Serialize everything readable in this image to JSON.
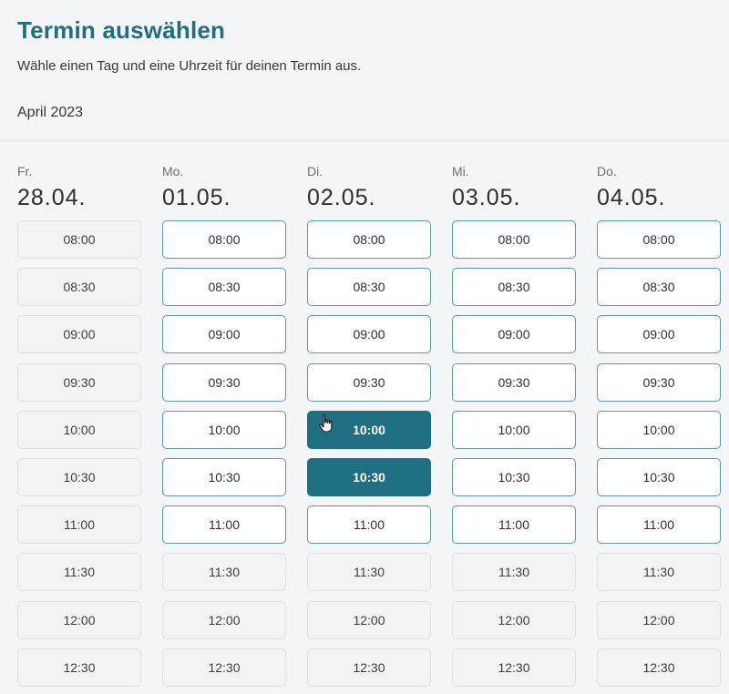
{
  "header": {
    "title": "Termin auswählen",
    "subtitle": "Wähle einen Tag und eine Uhrzeit für deinen Termin aus.",
    "month": "April 2023"
  },
  "colors": {
    "accent": "#1f6f82",
    "available_border": "#5a9aa8",
    "disabled_bg": "#f2f3f4"
  },
  "days": [
    {
      "weekday": "Fr.",
      "date": "28.04.",
      "slots": [
        {
          "time": "08:00",
          "state": "disabled"
        },
        {
          "time": "08:30",
          "state": "disabled"
        },
        {
          "time": "09:00",
          "state": "disabled"
        },
        {
          "time": "09:30",
          "state": "disabled"
        },
        {
          "time": "10:00",
          "state": "disabled"
        },
        {
          "time": "10:30",
          "state": "disabled"
        },
        {
          "time": "11:00",
          "state": "disabled"
        },
        {
          "time": "11:30",
          "state": "disabled"
        },
        {
          "time": "12:00",
          "state": "disabled"
        },
        {
          "time": "12:30",
          "state": "disabled"
        }
      ]
    },
    {
      "weekday": "Mo.",
      "date": "01.05.",
      "slots": [
        {
          "time": "08:00",
          "state": "available"
        },
        {
          "time": "08:30",
          "state": "available"
        },
        {
          "time": "09:00",
          "state": "available"
        },
        {
          "time": "09:30",
          "state": "available"
        },
        {
          "time": "10:00",
          "state": "available"
        },
        {
          "time": "10:30",
          "state": "available"
        },
        {
          "time": "11:00",
          "state": "available"
        },
        {
          "time": "11:30",
          "state": "disabled"
        },
        {
          "time": "12:00",
          "state": "disabled"
        },
        {
          "time": "12:30",
          "state": "disabled"
        }
      ]
    },
    {
      "weekday": "Di.",
      "date": "02.05.",
      "slots": [
        {
          "time": "08:00",
          "state": "available"
        },
        {
          "time": "08:30",
          "state": "available"
        },
        {
          "time": "09:00",
          "state": "available"
        },
        {
          "time": "09:30",
          "state": "available"
        },
        {
          "time": "10:00",
          "state": "selected"
        },
        {
          "time": "10:30",
          "state": "selected"
        },
        {
          "time": "11:00",
          "state": "available"
        },
        {
          "time": "11:30",
          "state": "disabled"
        },
        {
          "time": "12:00",
          "state": "disabled"
        },
        {
          "time": "12:30",
          "state": "disabled"
        }
      ]
    },
    {
      "weekday": "Mi.",
      "date": "03.05.",
      "slots": [
        {
          "time": "08:00",
          "state": "available"
        },
        {
          "time": "08:30",
          "state": "available"
        },
        {
          "time": "09:00",
          "state": "available"
        },
        {
          "time": "09:30",
          "state": "available"
        },
        {
          "time": "10:00",
          "state": "available"
        },
        {
          "time": "10:30",
          "state": "available"
        },
        {
          "time": "11:00",
          "state": "available"
        },
        {
          "time": "11:30",
          "state": "disabled"
        },
        {
          "time": "12:00",
          "state": "disabled"
        },
        {
          "time": "12:30",
          "state": "disabled"
        }
      ]
    },
    {
      "weekday": "Do.",
      "date": "04.05.",
      "slots": [
        {
          "time": "08:00",
          "state": "available"
        },
        {
          "time": "08:30",
          "state": "available"
        },
        {
          "time": "09:00",
          "state": "available"
        },
        {
          "time": "09:30",
          "state": "available"
        },
        {
          "time": "10:00",
          "state": "available"
        },
        {
          "time": "10:30",
          "state": "available"
        },
        {
          "time": "11:00",
          "state": "available"
        },
        {
          "time": "11:30",
          "state": "disabled"
        },
        {
          "time": "12:00",
          "state": "disabled"
        },
        {
          "time": "12:30",
          "state": "disabled"
        }
      ]
    }
  ],
  "cursor": {
    "icon": "hand-pointer-icon"
  }
}
